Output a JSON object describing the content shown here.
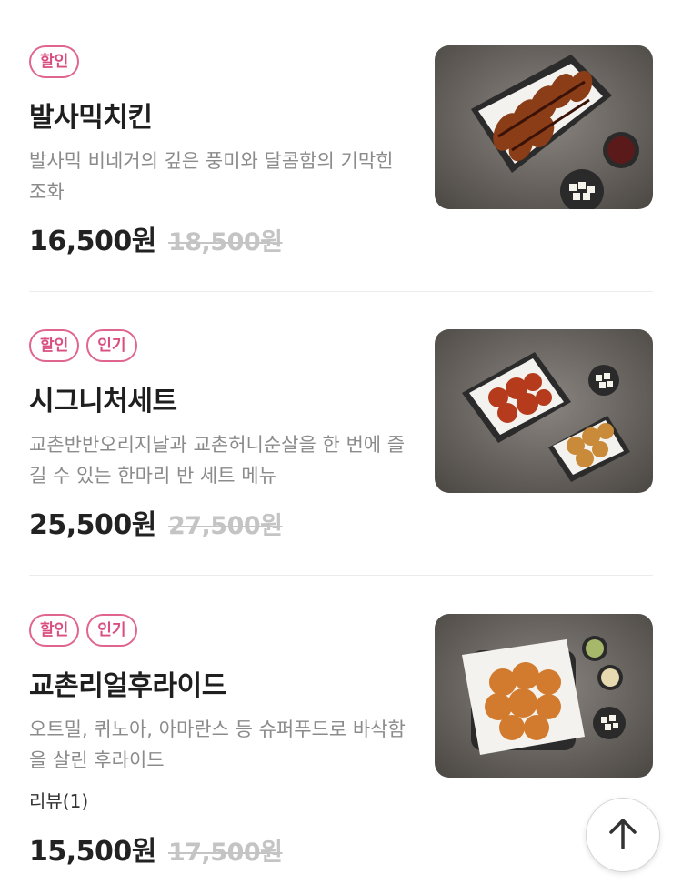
{
  "menu": {
    "items": [
      {
        "badges": [
          "할인"
        ],
        "name": "발사믹치킨",
        "description": "발사믹 비네거의 깊은 풍미와 달콤함의 기막힌 조화",
        "price": "16,500원",
        "original_price": "18,500원"
      },
      {
        "badges": [
          "할인",
          "인기"
        ],
        "name": "시그니처세트",
        "description": "교촌반반오리지날과 교촌허니순살을 한 번에 즐길 수 있는 한마리 반 세트 메뉴",
        "price": "25,500원",
        "original_price": "27,500원"
      },
      {
        "badges": [
          "할인",
          "인기"
        ],
        "name": "교촌리얼후라이드",
        "description": "오트밀, 퀴노아, 아마란스 등 슈퍼푸드로 바삭함을 살린 후라이드",
        "review": "리뷰(1)",
        "price": "15,500원",
        "original_price": "17,500원"
      }
    ]
  },
  "icons": {
    "scroll_top": "arrow-up-icon"
  },
  "colors": {
    "badge": "#d94f80",
    "strike_price": "#c4c4c4",
    "description": "#8b8b8b"
  }
}
